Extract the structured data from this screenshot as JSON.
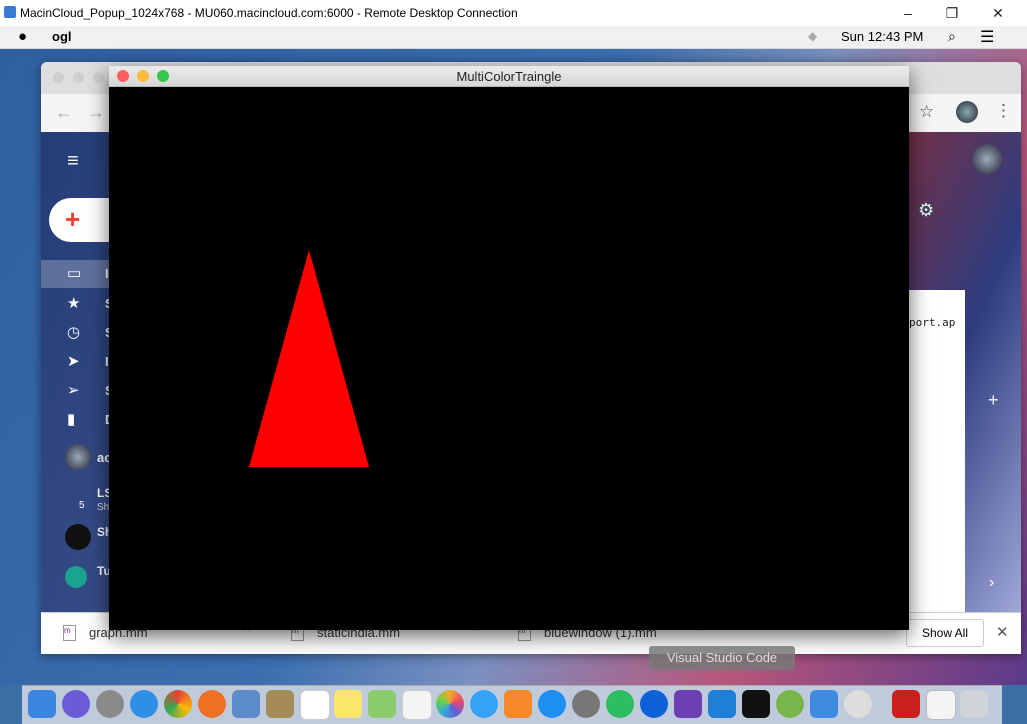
{
  "rdp": {
    "title": "MacinCloud_Popup_1024x768 - MU060.macincloud.com:6000 - Remote Desktop Connection",
    "minimize": "–",
    "restore": "❐",
    "close": "✕"
  },
  "menubar": {
    "app_name": "ogl",
    "clock": "Sun 12:43 PM"
  },
  "ogl_window": {
    "title": "MultiColorTraingle",
    "triangle_color": "#ff0000"
  },
  "gmail": {
    "sidebar_letters": [
      "I",
      "S",
      "S",
      "I",
      "S",
      "D"
    ],
    "account_label": "ac",
    "chats": [
      {
        "name": "LS",
        "sub": "Sh",
        "count": "5"
      },
      {
        "name": "Sh",
        "sub": ""
      },
      {
        "name": "Tu",
        "sub": ""
      }
    ],
    "code_snippet": "port.ap"
  },
  "downloads": {
    "items": [
      {
        "name": "graph.mm"
      },
      {
        "name": "staticindia.mm"
      },
      {
        "name": "bluewindow (1).mm"
      }
    ],
    "show_all": "Show All",
    "close": "✕"
  },
  "dock": {
    "tooltip": "Visual Studio Code"
  },
  "colors": {
    "accent": "#4285f4",
    "close": "#fc605c",
    "minimize": "#fdbc40",
    "maximize": "#34c84a"
  }
}
